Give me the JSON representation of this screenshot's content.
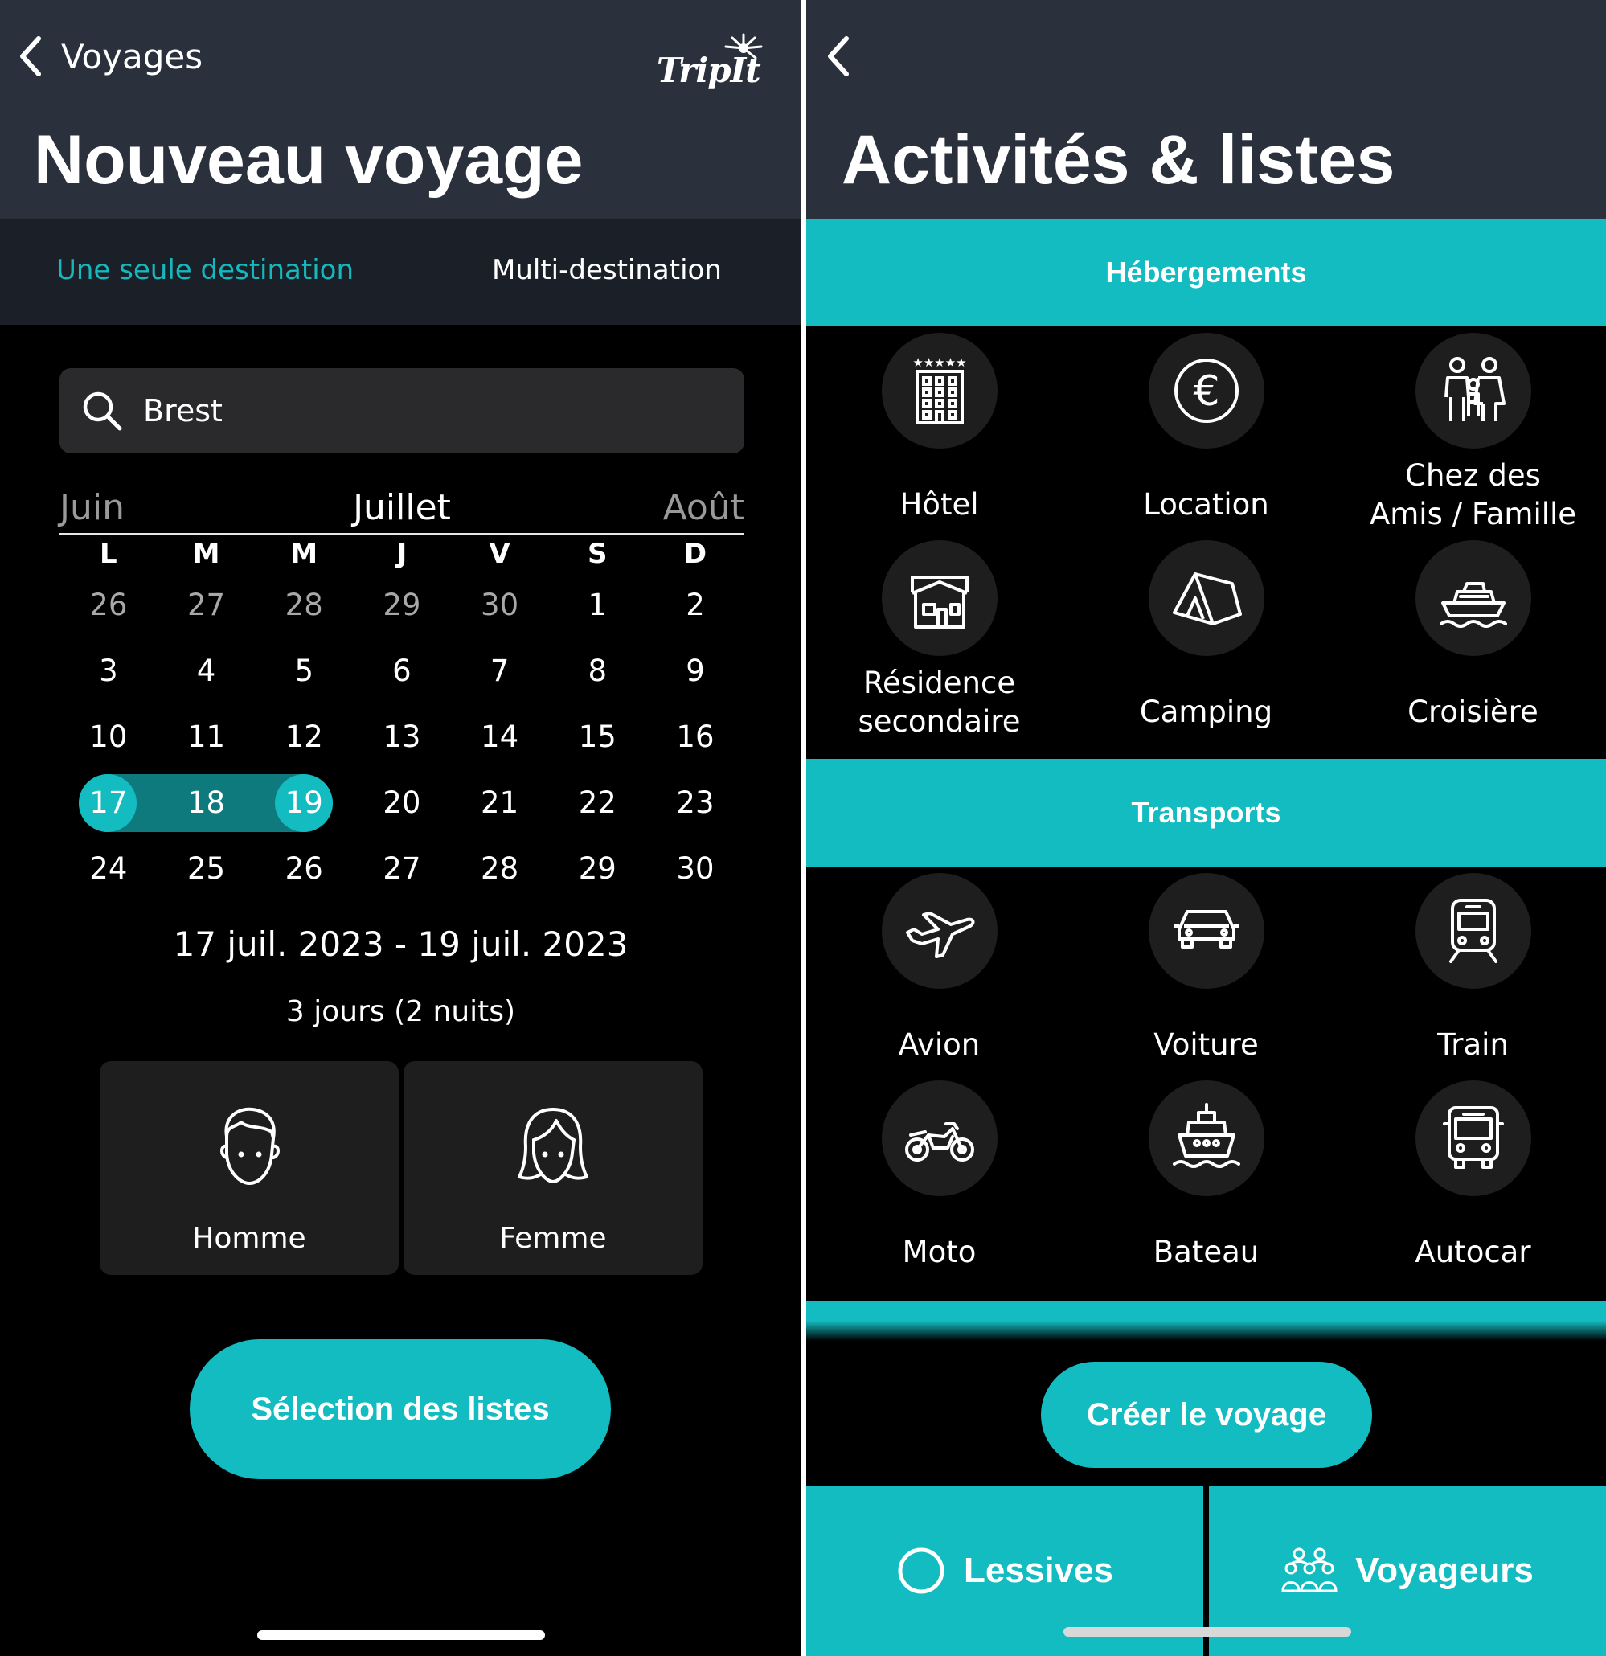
{
  "left": {
    "back_label": "Voyages",
    "logo_text": "TripIt",
    "title": "Nouveau voyage",
    "tabs": {
      "single": "Une seule destination",
      "multi": "Multi-destination"
    },
    "search": {
      "value": "Brest"
    },
    "calendar": {
      "prev_month": "Juin",
      "current_month": "Juillet",
      "next_month": "Août",
      "weekdays": [
        "L",
        "M",
        "M",
        "J",
        "V",
        "S",
        "D"
      ],
      "weeks": [
        [
          "26",
          "27",
          "28",
          "29",
          "30",
          "1",
          "2"
        ],
        [
          "3",
          "4",
          "5",
          "6",
          "7",
          "8",
          "9"
        ],
        [
          "10",
          "11",
          "12",
          "13",
          "14",
          "15",
          "16"
        ],
        [
          "17",
          "18",
          "19",
          "20",
          "21",
          "22",
          "23"
        ],
        [
          "24",
          "25",
          "26",
          "27",
          "28",
          "29",
          "30"
        ]
      ],
      "selected_start": "17",
      "selected_end": "19"
    },
    "date_range": "17 juil. 2023 - 19 juil. 2023",
    "duration": "3 jours (2 nuits)",
    "gender": {
      "male": "Homme",
      "female": "Femme"
    },
    "primary_button": "Sélection des listes"
  },
  "right": {
    "title": "Activités & listes",
    "sections": {
      "hebergements": {
        "label": "Hébergements",
        "items": {
          "hotel": {
            "label": "Hôtel",
            "icon": "hotel-icon"
          },
          "location": {
            "label": "Location",
            "icon": "euro-icon"
          },
          "famille": {
            "label1": "Chez des",
            "label2": "Amis / Famille",
            "icon": "family-icon"
          },
          "residence": {
            "label1": "Résidence",
            "label2": "secondaire",
            "icon": "house-icon"
          },
          "camping": {
            "label": "Camping",
            "icon": "tent-icon"
          },
          "croisiere": {
            "label": "Croisière",
            "icon": "cruise-ship-icon"
          }
        }
      },
      "transports": {
        "label": "Transports",
        "items": {
          "avion": {
            "label": "Avion",
            "icon": "plane-icon"
          },
          "voiture": {
            "label": "Voiture",
            "icon": "car-icon"
          },
          "train": {
            "label": "Train",
            "icon": "train-icon"
          },
          "moto": {
            "label": "Moto",
            "icon": "motorcycle-icon"
          },
          "bateau": {
            "label": "Bateau",
            "icon": "boat-icon"
          },
          "autocar": {
            "label": "Autocar",
            "icon": "bus-icon"
          }
        }
      }
    },
    "primary_button": "Créer le voyage",
    "bottom_tabs": {
      "lessives": "Lessives",
      "voyageurs": "Voyageurs"
    }
  },
  "colors": {
    "accent": "#12bcc1",
    "header_bg": "#2b313c",
    "tile_bg": "#1e1e1f",
    "range_bg": "#0e7a7e"
  }
}
